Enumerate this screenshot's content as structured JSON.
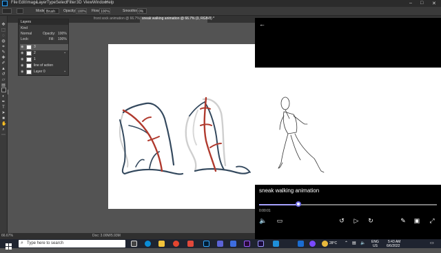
{
  "menubar": {
    "items": [
      "File",
      "Edit",
      "Image",
      "Layer",
      "Type",
      "Select",
      "Filter",
      "3D",
      "View",
      "Window",
      "Help"
    ],
    "window_controls": {
      "minimize": "–",
      "maximize": "□",
      "close": "✕"
    }
  },
  "options": {
    "mode_label": "Mode:",
    "mode_value": "Brush",
    "opacity_label": "Opacity:",
    "opacity_value": "100%",
    "flow_label": "Flow:",
    "flow_value": "100%",
    "smoothing_label": "Smoothing:",
    "smoothing_value": "0%"
  },
  "tabs": [
    {
      "label": "front sock animation @ 66.7% (Layer 1, RGB/8#) *"
    },
    {
      "label": "sneak walking animation @ 66.7% (3, RGB/8) *"
    }
  ],
  "layers_panel": {
    "title": "Layers",
    "kind": "Kind",
    "blend": "Normal",
    "opacity_label": "Opacity:",
    "opacity": "100%",
    "fill_label": "Fill:",
    "fill": "100%",
    "lock_label": "Lock:",
    "rows": [
      {
        "name": "3"
      },
      {
        "name": "2"
      },
      {
        "name": "1"
      },
      {
        "name": "line of action"
      },
      {
        "name": "Layer 0"
      }
    ]
  },
  "status": {
    "zoom": "66.67%",
    "doc": "Doc: 3.00M/5.93M"
  },
  "player": {
    "title": "sneak walking animation",
    "time": "0:00:01",
    "progress": 0.22,
    "back_icon": "←"
  },
  "taskbar": {
    "search_placeholder": "Type here to search",
    "weather": "28°C",
    "lang": "ENG",
    "region": "US",
    "time": "5:43 AM",
    "date": "6/6/2022"
  },
  "colors": {
    "accent": "#6e6ce8",
    "stroke": "#34495e",
    "line_of_action": "#b03a2e"
  }
}
